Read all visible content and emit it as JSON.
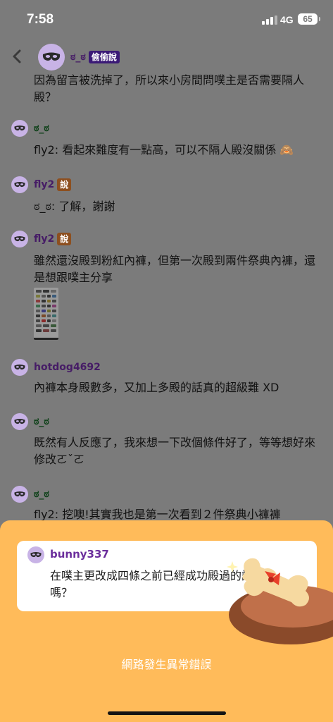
{
  "status_bar": {
    "time": "7:58",
    "network": "4G",
    "battery": "65"
  },
  "chat": {
    "first": {
      "user": "ಠ_ಠ",
      "tag": "偷偷說",
      "text": "因為留言被洗掉了，所以來小房間問噗主是否需要隔人殿？"
    },
    "messages": [
      {
        "user": "ಠ_ಠ",
        "tag": "",
        "text": "fly2: 看起來難度有一點高，可以不隔人殿沒關係 🙈"
      },
      {
        "user": "fly2",
        "tag": "說",
        "text": "ಠ_ಠ: 了解，謝謝"
      },
      {
        "user": "fly2",
        "tag": "說",
        "text": "雖然還沒殿到粉紅內褲，但第一次殿到兩件祭典內褲，還是想跟噗主分享"
      },
      {
        "user": "hotdog4692",
        "tag": "",
        "text": "內褲本身殿數多，又加上多殿的話真的超級難 XD"
      },
      {
        "user": "ಠ_ಠ",
        "tag": "",
        "text": "既然有人反應了，我來想一下改個條件好了，等等想好來修改ㄛˇㄛ"
      },
      {
        "user": "ಠ_ಠ",
        "tag": "",
        "text": "fly2: 挖噢!其實我也是第一次看到２件祭典小褲褲"
      }
    ]
  },
  "reply_card": {
    "user": "bunny337",
    "text": "在噗主更改成四條之前已經成功殿過的話 算嗎？"
  },
  "error_message": "網路發生異常錯誤",
  "colors": {
    "sheet": "#ffbb5a",
    "overlay": "#7b7b7b",
    "tag_secret": "#3b1a76",
    "tag_say": "#8d4f1f"
  },
  "icons": [
    "back-chevron-icon",
    "mask-avatar-icon",
    "bone-mascot-icon"
  ]
}
